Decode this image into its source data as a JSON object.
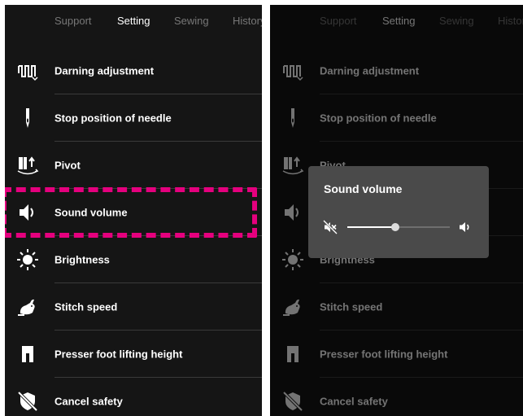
{
  "tabs": [
    "Support",
    "Setting",
    "Sewing",
    "History"
  ],
  "active_tab": "Setting",
  "menu_items": [
    {
      "label": "Darning adjustment",
      "icon": "darning-icon"
    },
    {
      "label": "Stop position of needle",
      "icon": "needle-icon"
    },
    {
      "label": "Pivot",
      "icon": "pivot-icon"
    },
    {
      "label": "Sound volume",
      "icon": "speaker-icon"
    },
    {
      "label": "Brightness",
      "icon": "brightness-icon"
    },
    {
      "label": "Stitch speed",
      "icon": "rabbit-icon"
    },
    {
      "label": "Presser foot lifting height",
      "icon": "presser-foot-icon"
    },
    {
      "label": "Cancel safety",
      "icon": "cancel-safety-icon"
    }
  ],
  "highlighted_item": "Sound volume",
  "dialog": {
    "title": "Sound volume",
    "volume_level": 0.47
  },
  "colors": {
    "background": "#151515",
    "highlight": "#e5007e",
    "dialog_bg": "#4a4a4a",
    "text": "#ffffff",
    "tab_inactive": "#777777"
  }
}
